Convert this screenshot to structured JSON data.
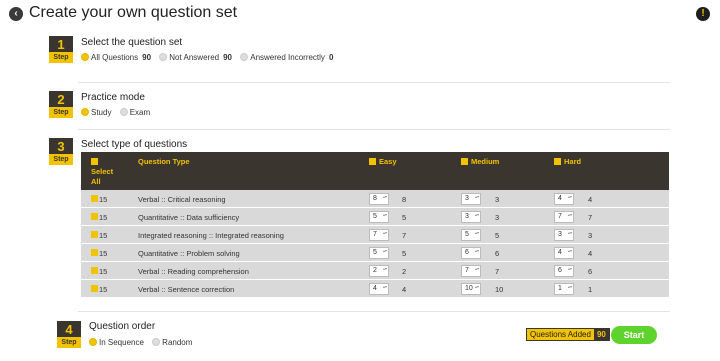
{
  "header": {
    "title": "Create your own question set",
    "back_glyph": "‹",
    "alert_glyph": "!",
    "icons": {
      "back": "back-arrow-icon",
      "alert": "alert-icon"
    }
  },
  "steps": [
    {
      "number": "1",
      "label": "Step",
      "title": "Select the question set"
    },
    {
      "number": "2",
      "label": "Step",
      "title": "Practice mode"
    },
    {
      "number": "3",
      "label": "Step",
      "title": "Select type of questions"
    },
    {
      "number": "4",
      "label": "Step",
      "title": "Question order"
    }
  ],
  "question_set": {
    "options": [
      {
        "label": "All Questions",
        "count": "90",
        "selected": true
      },
      {
        "label": "Not Answered",
        "count": "90",
        "selected": false
      },
      {
        "label": "Answered Incorrectly",
        "count": "0",
        "selected": false
      }
    ]
  },
  "practice_mode": {
    "options": [
      {
        "label": "Study",
        "selected": true
      },
      {
        "label": "Exam",
        "selected": false
      }
    ]
  },
  "question_types": {
    "headers": {
      "select_all": "Select All",
      "question_type": "Question Type",
      "easy": "Easy",
      "medium": "Medium",
      "hard": "Hard"
    },
    "rows": [
      {
        "total": "15",
        "type": "Verbal :: Critical reasoning",
        "easy_value": "8",
        "easy_avail": "8",
        "medium_value": "3",
        "medium_avail": "3",
        "hard_value": "4",
        "hard_avail": "4"
      },
      {
        "total": "15",
        "type": "Quantitative :: Data sufficiency",
        "easy_value": "5",
        "easy_avail": "5",
        "medium_value": "3",
        "medium_avail": "3",
        "hard_value": "7",
        "hard_avail": "7"
      },
      {
        "total": "15",
        "type": "Integrated reasoning :: Integrated reasoning",
        "easy_value": "7",
        "easy_avail": "7",
        "medium_value": "5",
        "medium_avail": "5",
        "hard_value": "3",
        "hard_avail": "3"
      },
      {
        "total": "15",
        "type": "Quantitative :: Problem solving",
        "easy_value": "5",
        "easy_avail": "5",
        "medium_value": "6",
        "medium_avail": "6",
        "hard_value": "4",
        "hard_avail": "4"
      },
      {
        "total": "15",
        "type": "Verbal :: Reading comprehension",
        "easy_value": "2",
        "easy_avail": "2",
        "medium_value": "7",
        "medium_avail": "7",
        "hard_value": "6",
        "hard_avail": "6"
      },
      {
        "total": "15",
        "type": "Verbal :: Sentence correction",
        "easy_value": "4",
        "easy_avail": "4",
        "medium_value": "10",
        "medium_avail": "10",
        "hard_value": "1",
        "hard_avail": "1"
      }
    ]
  },
  "question_order": {
    "options": [
      {
        "label": "In Sequence",
        "selected": true
      },
      {
        "label": "Random",
        "selected": false
      }
    ]
  },
  "footer": {
    "questions_added_label": "Questions Added",
    "questions_added_value": "90",
    "start_label": "Start"
  },
  "colors": {
    "accent": "#f2c300",
    "dark": "#3b3530",
    "start": "#5fd32d",
    "row": "#d9d9d9"
  }
}
